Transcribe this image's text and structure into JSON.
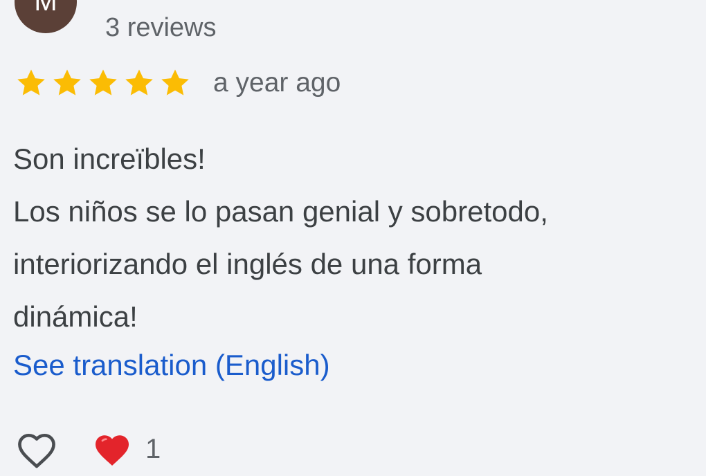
{
  "reviewer": {
    "avatar_initial": "M",
    "review_count": "3 reviews",
    "avatar_color": "#5b4037"
  },
  "rating": {
    "stars": 5,
    "max_stars": 5,
    "star_color": "#fbbc04",
    "time_ago": "a year ago"
  },
  "review": {
    "lines": [
      "Son increïbles!",
      "Los niños se lo pasan genial y sobretodo,",
      "interiorizando el inglés de una forma",
      "dinámica!"
    ],
    "translate_link": "See translation (English)",
    "link_color": "#1a5ccc"
  },
  "actions": {
    "like_icon": "heart-outline-icon",
    "reaction_icon": "red-heart-icon",
    "reaction_count": "1"
  }
}
